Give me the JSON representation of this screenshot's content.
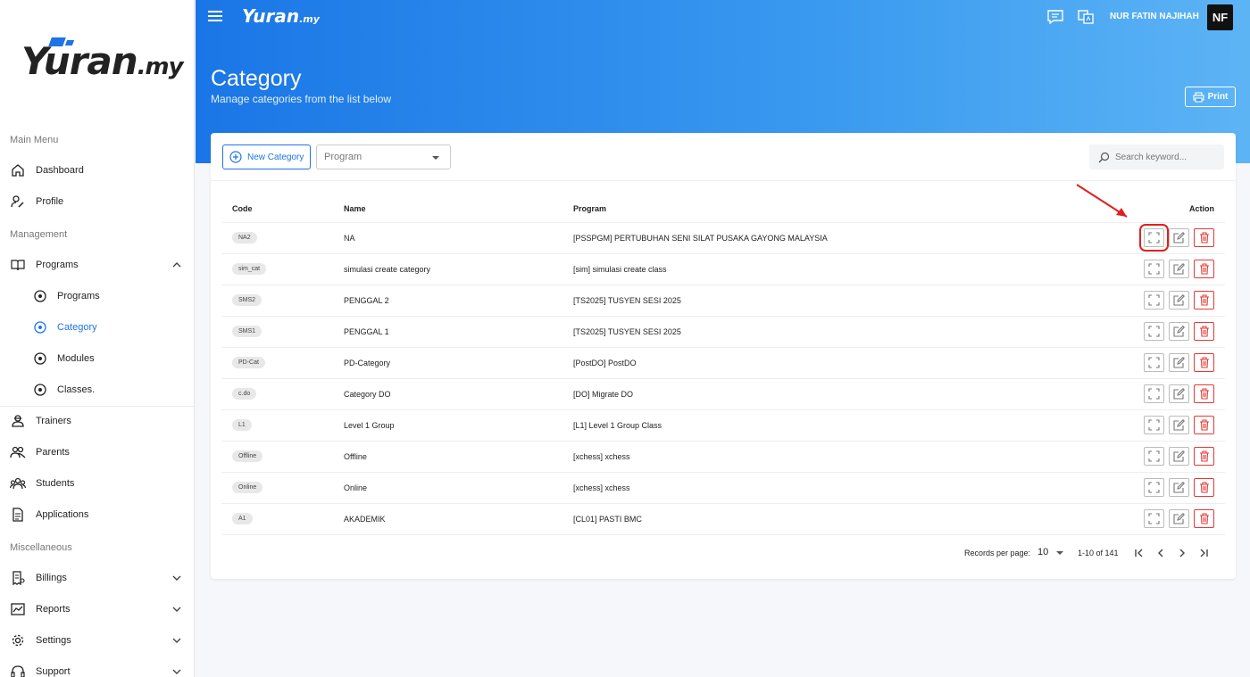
{
  "sidebar": {
    "logo_main": "Yuran",
    "logo_suffix": ".my",
    "sections": {
      "main": "Main Menu",
      "management": "Management",
      "misc": "Miscellaneous"
    },
    "items": {
      "dashboard": "Dashboard",
      "profile": "Profile",
      "programs": "Programs",
      "programs_sub": "Programs",
      "category": "Category",
      "modules": "Modules",
      "classes": "Classes.",
      "trainers": "Trainers",
      "parents": "Parents",
      "students": "Students",
      "applications": "Applications",
      "billings": "Billings",
      "reports": "Reports",
      "settings": "Settings",
      "support": "Support"
    }
  },
  "header": {
    "logo_main": "Yuran",
    "logo_suffix": ".my",
    "user_name": "NUR FATIN NAJIHAH",
    "avatar_initials": "NF",
    "title": "Category",
    "subtitle": "Manage categories from the list below",
    "print_label": "Print"
  },
  "toolbar": {
    "new_label": "New Category",
    "program_placeholder": "Program",
    "search_placeholder": "Search keyword..."
  },
  "table": {
    "headers": {
      "code": "Code",
      "name": "Name",
      "program": "Program",
      "action": "Action"
    },
    "rows": [
      {
        "code": "NA2",
        "name": "NA",
        "program": "[PSSPGM] PERTUBUHAN SENI SILAT PUSAKA GAYONG MALAYSIA"
      },
      {
        "code": "sim_cat",
        "name": "simulasi create category",
        "program": "[sim] simulasi create class"
      },
      {
        "code": "SMS2",
        "name": "PENGGAL 2",
        "program": "[TS2025] TUSYEN SESI 2025"
      },
      {
        "code": "SMS1",
        "name": "PENGGAL 1",
        "program": "[TS2025] TUSYEN SESI 2025"
      },
      {
        "code": "PD-Cat",
        "name": "PD-Category",
        "program": "[PostDO] PostDO"
      },
      {
        "code": "c.do",
        "name": "Category DO",
        "program": "[DO] Migrate DO"
      },
      {
        "code": "L1",
        "name": "Level 1 Group",
        "program": "[L1] Level 1 Group Class"
      },
      {
        "code": "Offline",
        "name": "Offline",
        "program": "[xchess] xchess"
      },
      {
        "code": "Online",
        "name": "Online",
        "program": "[xchess] xchess"
      },
      {
        "code": "A1",
        "name": "AKADEMIK",
        "program": "[CL01] PASTI BMC"
      }
    ]
  },
  "pagination": {
    "records_label": "Records per page:",
    "per_page": "10",
    "range": "1-10 of 141"
  },
  "colors": {
    "accent": "#1e73e8",
    "danger": "#e53935",
    "highlight": "#e02020"
  }
}
